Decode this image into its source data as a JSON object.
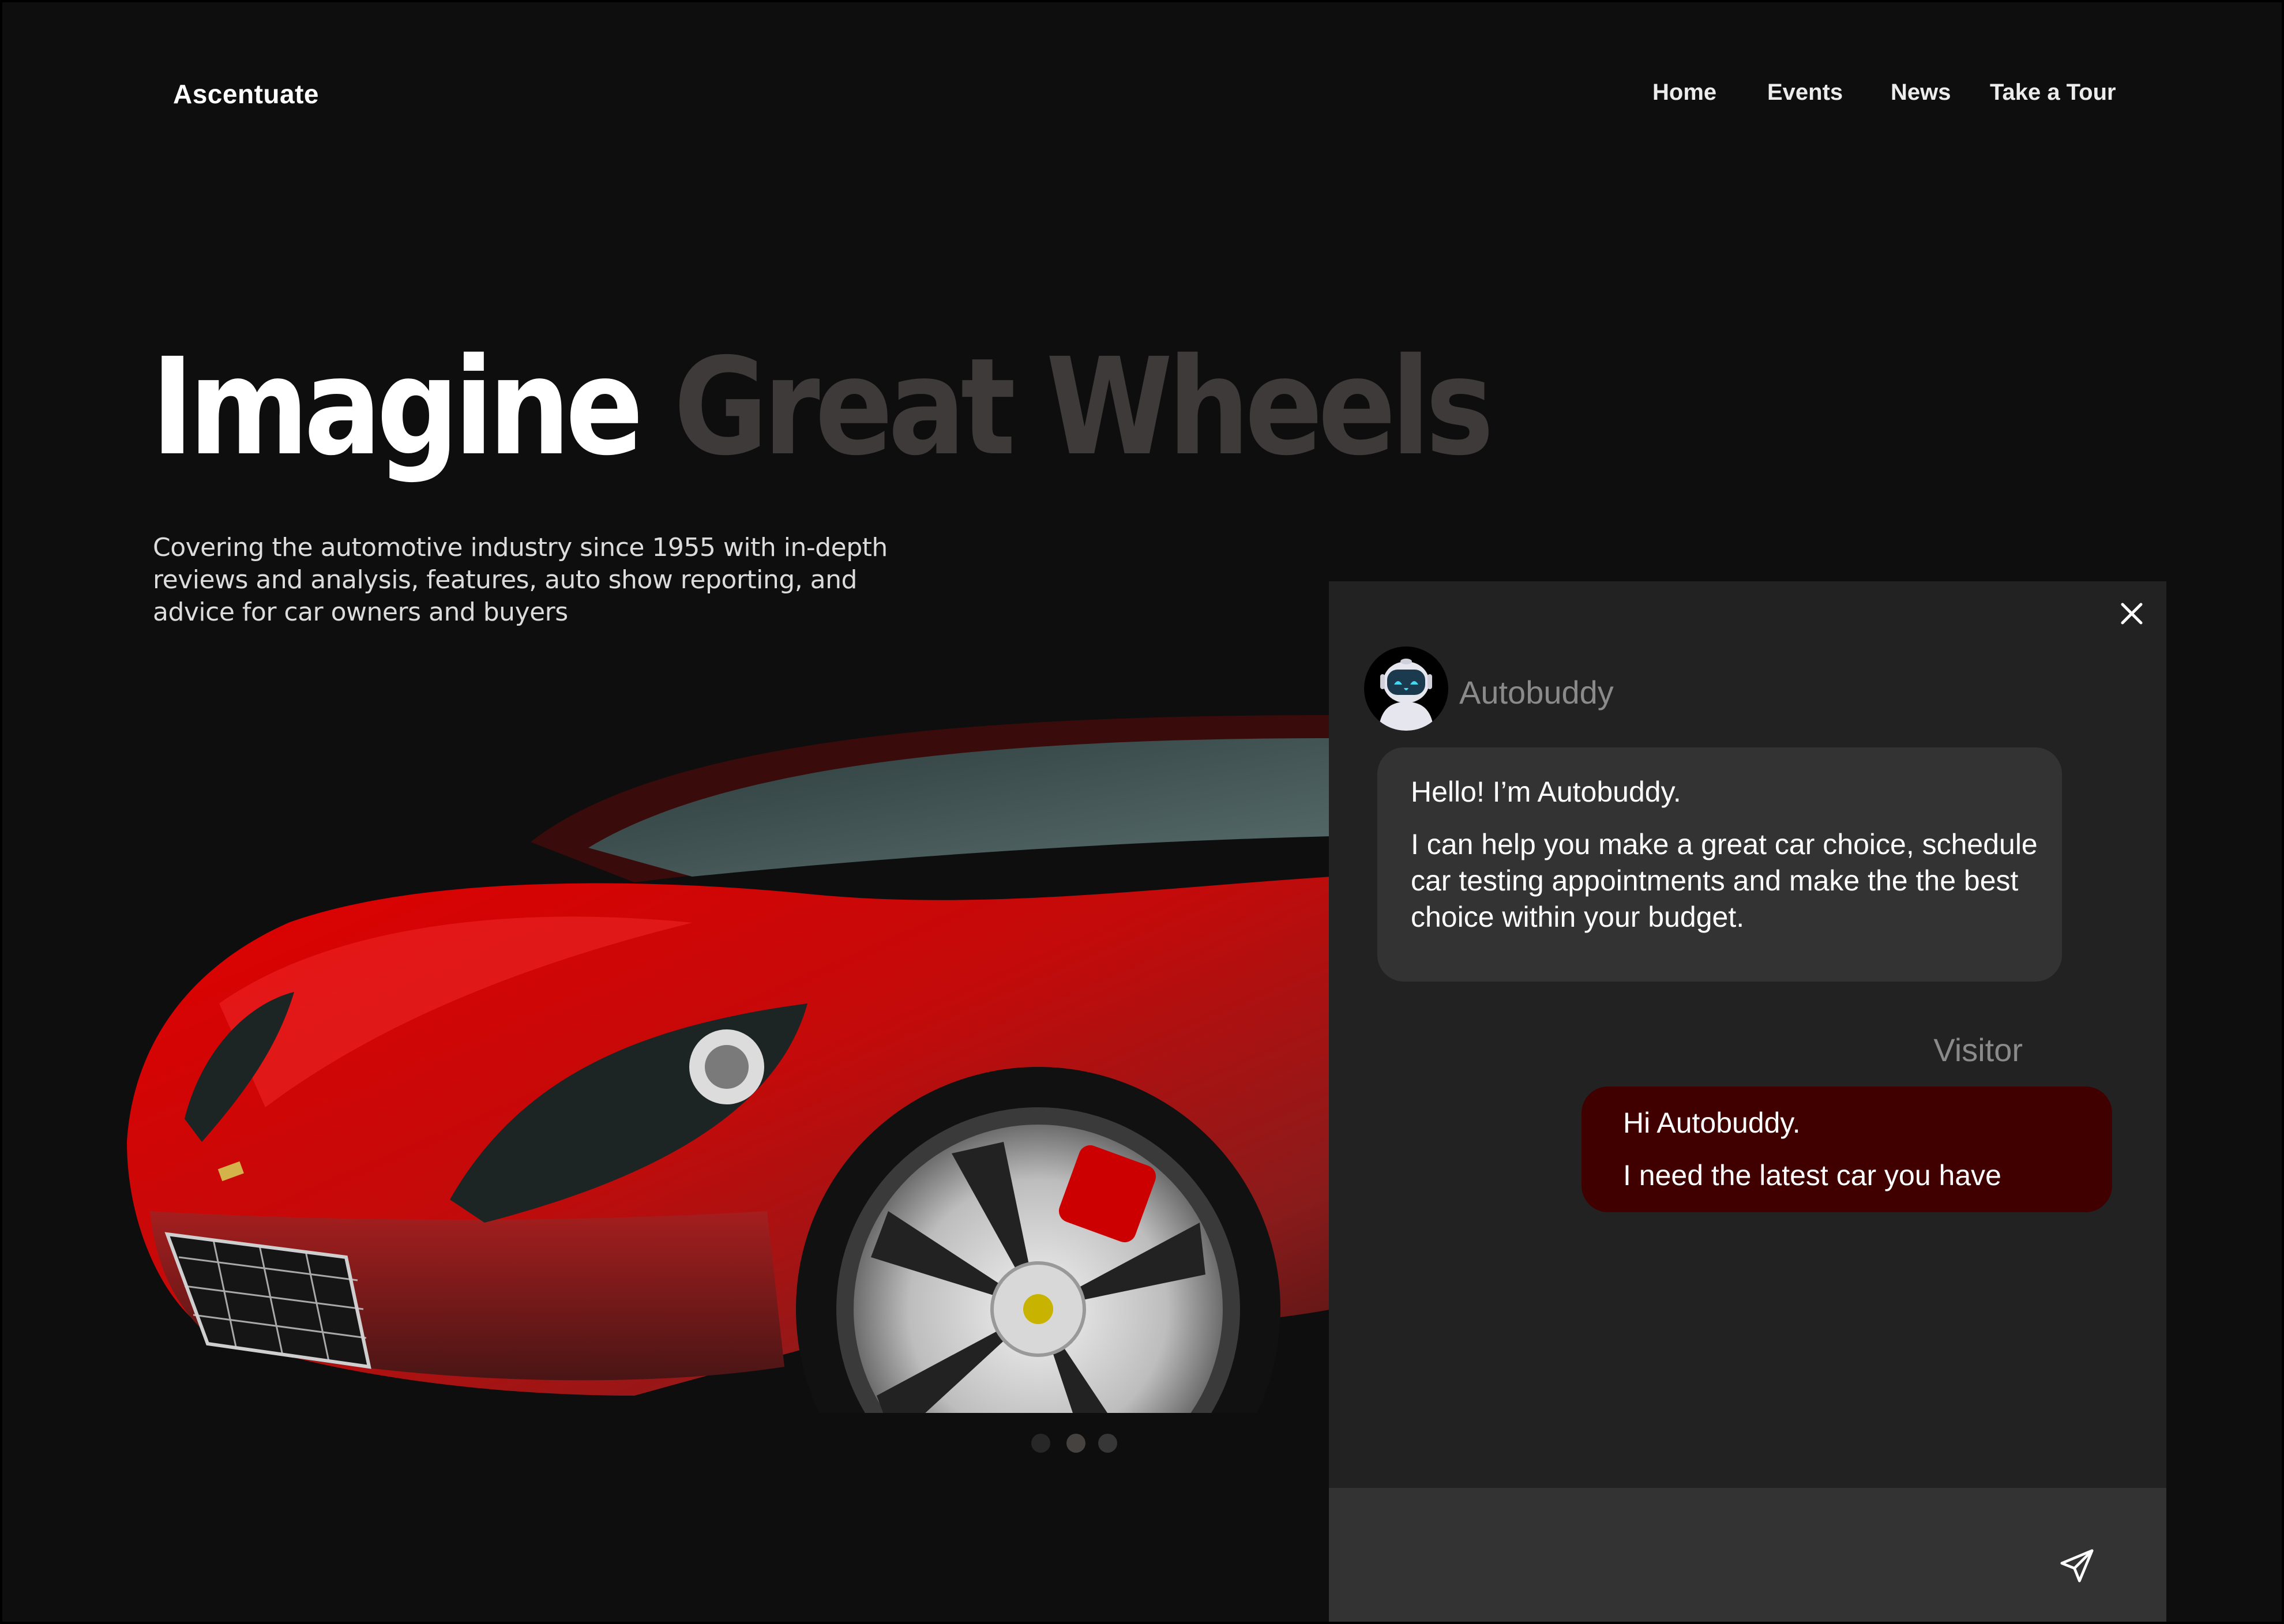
{
  "header": {
    "logo": "Ascentuate",
    "nav": [
      {
        "label": "Home"
      },
      {
        "label": "Events"
      },
      {
        "label": "News"
      },
      {
        "label": "Take a Tour"
      }
    ]
  },
  "hero": {
    "title_primary": "Imagine",
    "title_secondary": "Great Wheels",
    "subtitle": "Covering the automotive industry since 1955 with in-depth reviews and analysis, features, auto show reporting, and advice for car owners and buyers",
    "image": "red-sports-car",
    "carousel": {
      "total": 3,
      "active_index": 1
    }
  },
  "chat": {
    "close_icon": "close-icon",
    "bot": {
      "name": "Autobuddy",
      "avatar": "robot-avatar",
      "messages": [
        "Hello! I’m Autobuddy.",
        "I can help you make a great car choice, schedule car testing appointments and make the the best choice within your budget."
      ]
    },
    "visitor": {
      "name": "Visitor",
      "messages": [
        "Hi Autobuddy.",
        "I need the latest car you have"
      ]
    },
    "input": {
      "value": "",
      "placeholder": ""
    },
    "send_icon": "send-icon"
  },
  "colors": {
    "page_bg": "#0e0e0e",
    "panel_bg": "#222222",
    "bot_bubble": "#333333",
    "visitor_bubble": "#400000",
    "title_dim": "#3d3a39",
    "muted_text": "#8a8a8a"
  }
}
